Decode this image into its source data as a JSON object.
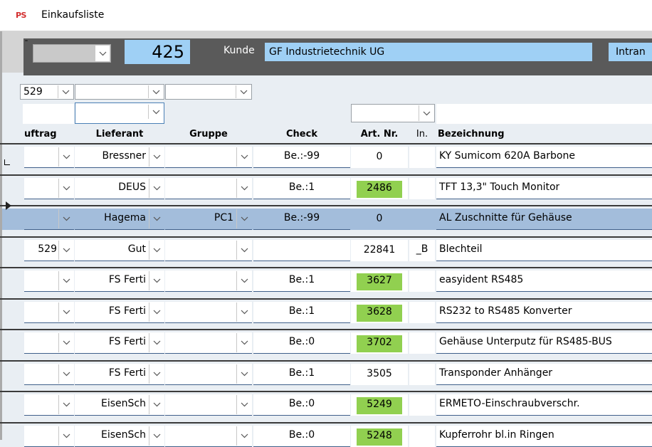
{
  "window": {
    "icon": "ps-app-icon",
    "app_icon_text": "PS",
    "title": "Einkaufsliste"
  },
  "header": {
    "order_number": "425",
    "kunde_label": "Kunde",
    "kunde_value": "GF Industrietechnik UG",
    "intranet_value": "Intran"
  },
  "filters": {
    "auftrag_value": "529"
  },
  "columns": [
    "uftrag",
    "Lieferant",
    "Gruppe",
    "Check",
    "Art. Nr.",
    "In.",
    "Bezeichnung"
  ],
  "rows": [
    {
      "auftrag": "",
      "lieferant": "Bressner",
      "gruppe": "",
      "check": "Be.:-99",
      "artnr": "0",
      "in": "",
      "bezeichnung": "KY Sumicom 620A Barbone",
      "artnr_green": false,
      "selected": false
    },
    {
      "auftrag": "",
      "lieferant": "DEUS",
      "gruppe": "",
      "check": "Be.:1",
      "artnr": "2486",
      "in": "",
      "bezeichnung": "TFT 13,3\" Touch Monitor",
      "artnr_green": true,
      "selected": false
    },
    {
      "auftrag": "",
      "lieferant": "Hagema",
      "gruppe": "PC1",
      "check": "Be.:-99",
      "artnr": "0",
      "in": "",
      "bezeichnung": "AL Zuschnitte für Gehäuse",
      "artnr_green": false,
      "selected": true
    },
    {
      "auftrag": "529",
      "lieferant": "Gut",
      "gruppe": "",
      "check": "",
      "artnr": "22841",
      "in": "_B",
      "bezeichnung": "Blechteil",
      "artnr_green": false,
      "selected": false
    },
    {
      "auftrag": "",
      "lieferant": "FS Ferti",
      "gruppe": "",
      "check": "Be.:1",
      "artnr": "3627",
      "in": "",
      "bezeichnung": "easyident RS485",
      "artnr_green": true,
      "selected": false
    },
    {
      "auftrag": "",
      "lieferant": "FS Ferti",
      "gruppe": "",
      "check": "Be.:1",
      "artnr": "3628",
      "in": "",
      "bezeichnung": "RS232 to RS485 Konverter",
      "artnr_green": true,
      "selected": false
    },
    {
      "auftrag": "",
      "lieferant": "FS Ferti",
      "gruppe": "",
      "check": "Be.:0",
      "artnr": "3702",
      "in": "",
      "bezeichnung": "Gehäuse Unterputz für RS485-BUS",
      "artnr_green": true,
      "selected": false
    },
    {
      "auftrag": "",
      "lieferant": "FS Ferti",
      "gruppe": "",
      "check": "Be.:1",
      "artnr": "3505",
      "in": "",
      "bezeichnung": "Transponder Anhänger",
      "artnr_green": false,
      "selected": false
    },
    {
      "auftrag": "",
      "lieferant": "EisenSch",
      "gruppe": "",
      "check": "Be.:0",
      "artnr": "5249",
      "in": "",
      "bezeichnung": "ERMETO-Einschraubverschr.",
      "artnr_green": true,
      "selected": false
    },
    {
      "auftrag": "",
      "lieferant": "EisenSch",
      "gruppe": "",
      "check": "Be.:0",
      "artnr": "5248",
      "in": "",
      "bezeichnung": "Kupferrohr bl.in Ringen",
      "artnr_green": true,
      "selected": false
    }
  ],
  "colors": {
    "highlight_blue": "#9fd0f5",
    "selected_row": "#a3bddb",
    "green": "#91d050",
    "header_dark": "#5a5a5a"
  }
}
